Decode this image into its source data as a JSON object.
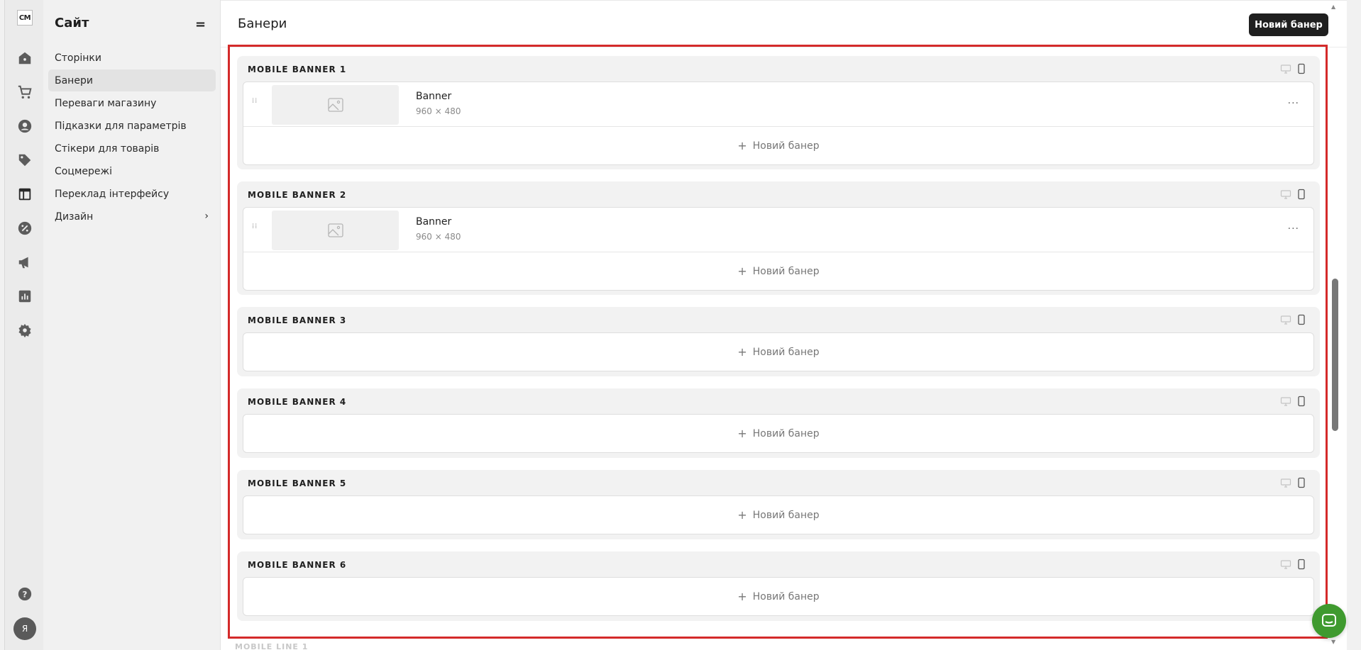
{
  "app": {
    "logo": "CM",
    "avatar_letter": "Я"
  },
  "nav": {
    "title": "Сайт",
    "toggle": "=",
    "items": [
      {
        "label": "Сторінки"
      },
      {
        "label": "Банери"
      },
      {
        "label": "Переваги магазину"
      },
      {
        "label": "Підказки для параметрів"
      },
      {
        "label": "Стікери для товарів"
      },
      {
        "label": "Соцмережі"
      },
      {
        "label": "Переклад інтерфейсу"
      },
      {
        "label": "Дизайн"
      }
    ]
  },
  "header": {
    "title": "Банери",
    "new_banner_button": "Новий банер"
  },
  "groups": [
    {
      "title": "MOBILE BANNER 1",
      "banner": {
        "name": "Banner",
        "size": "960 × 480"
      },
      "add_label": "Новий банер"
    },
    {
      "title": "MOBILE BANNER 2",
      "banner": {
        "name": "Banner",
        "size": "960 × 480"
      },
      "add_label": "Новий банер"
    },
    {
      "title": "MOBILE BANNER 3",
      "add_label": "Новий банер"
    },
    {
      "title": "MOBILE BANNER 4",
      "add_label": "Новий банер"
    },
    {
      "title": "MOBILE BANNER 5",
      "add_label": "Новий банер"
    },
    {
      "title": "MOBILE BANNER 6",
      "add_label": "Новий банер"
    }
  ],
  "peek_title": "MOBILE LINE 1",
  "colors": {
    "highlight_border": "#d42a2a",
    "chat_bubble": "#3f9a2f",
    "primary_button": "#1f1f1f"
  }
}
